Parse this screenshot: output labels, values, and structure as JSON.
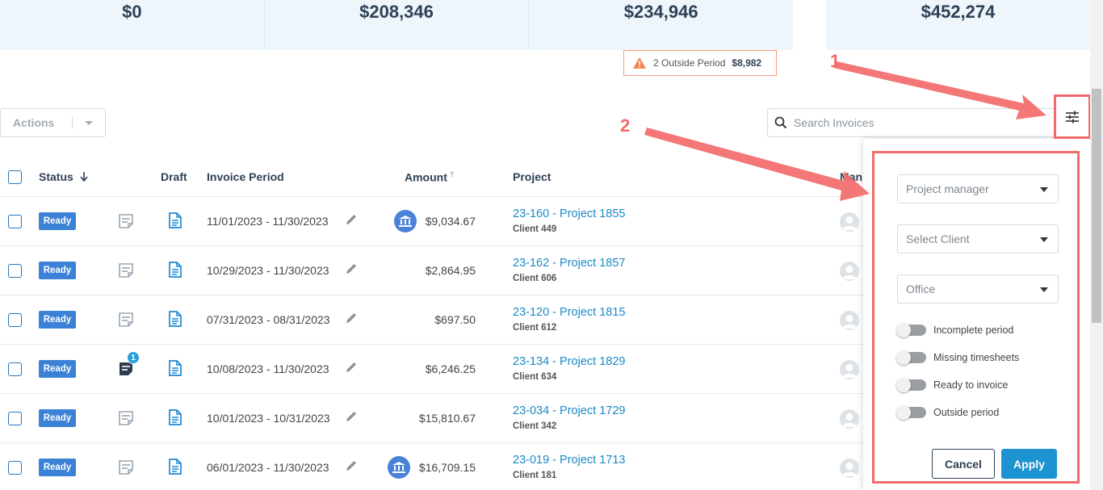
{
  "summary": {
    "cards": [
      {
        "value": "$0"
      },
      {
        "value": "$208,346"
      },
      {
        "value": "$234,946"
      }
    ],
    "right_card": {
      "value": "$452,274"
    },
    "outside_period": {
      "label": "2 Outside Period",
      "amount": "$8,982"
    }
  },
  "toolbar": {
    "actions_label": "Actions",
    "search_placeholder": "Search Invoices"
  },
  "table": {
    "headers": {
      "status": "Status",
      "draft": "Draft",
      "invoice_period": "Invoice Period",
      "amount": "Amount",
      "amount_help": "?",
      "project": "Project",
      "manager": "Man"
    },
    "rows": [
      {
        "status": "Ready",
        "note_count": "",
        "period": "11/01/2023 - 11/30/2023",
        "bank": true,
        "amount": "$9,034.67",
        "project": "23-160 - Project 1855",
        "client": "Client 449"
      },
      {
        "status": "Ready",
        "note_count": "",
        "period": "10/29/2023 - 11/30/2023",
        "bank": false,
        "amount": "$2,864.95",
        "project": "23-162 - Project 1857",
        "client": "Client 606"
      },
      {
        "status": "Ready",
        "note_count": "",
        "period": "07/31/2023 - 08/31/2023",
        "bank": false,
        "amount": "$697.50",
        "project": "23-120 - Project 1815",
        "client": "Client 612"
      },
      {
        "status": "Ready",
        "note_count": "1",
        "period": "10/08/2023 - 11/30/2023",
        "bank": false,
        "amount": "$6,246.25",
        "project": "23-134 - Project 1829",
        "client": "Client 634"
      },
      {
        "status": "Ready",
        "note_count": "",
        "period": "10/01/2023 - 10/31/2023",
        "bank": false,
        "amount": "$15,810.67",
        "project": "23-034 - Project 1729",
        "client": "Client 342"
      },
      {
        "status": "Ready",
        "note_count": "",
        "period": "06/01/2023 - 11/30/2023",
        "bank": true,
        "amount": "$16,709.15",
        "project": "23-019 - Project 1713",
        "client": "Client 181"
      }
    ]
  },
  "filter_panel": {
    "project_manager_placeholder": "Project manager",
    "client_placeholder": "Select Client",
    "office_placeholder": "Office",
    "toggles": [
      {
        "label": "Incomplete period",
        "on": false
      },
      {
        "label": "Missing timesheets",
        "on": false
      },
      {
        "label": "Ready to invoice",
        "on": false
      },
      {
        "label": "Outside period",
        "on": false
      }
    ],
    "cancel_label": "Cancel",
    "apply_label": "Apply"
  },
  "annotations": {
    "step1": "1",
    "step2": "2"
  },
  "colors": {
    "accent": "#1d93d2",
    "status_ready": "#3b82d6",
    "annotation": "#f26b6b",
    "link": "#1a8ac6"
  },
  "icons": [
    "warning-icon",
    "search-icon",
    "filter-sliders-icon",
    "sort-down-icon",
    "note-icon",
    "draft-document-icon",
    "edit-pencil-icon",
    "bank-icon",
    "user-avatar-icon",
    "chevron-down-icon"
  ]
}
